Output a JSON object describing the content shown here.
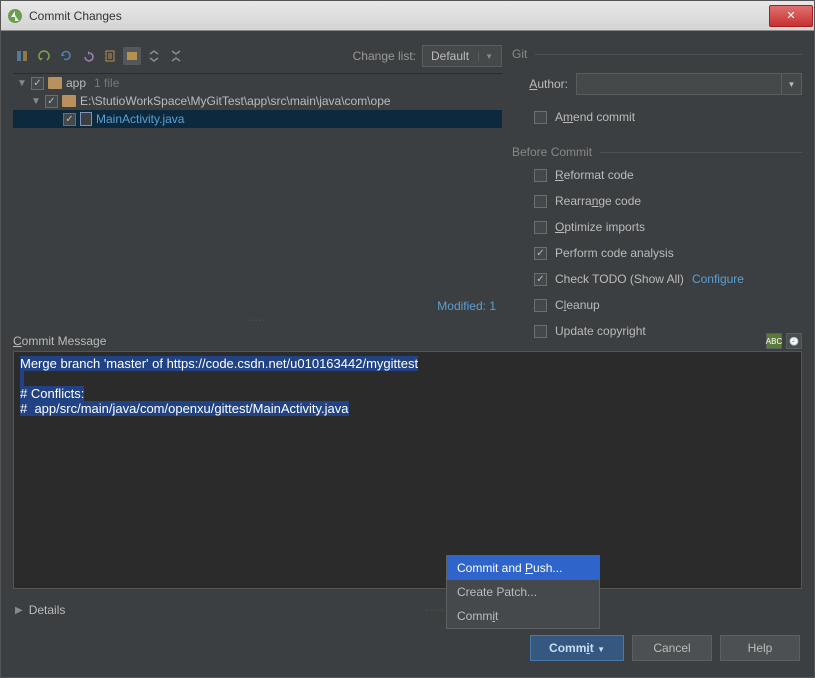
{
  "titlebar": {
    "title": "Commit Changes"
  },
  "changelist": {
    "label": "Change list:",
    "value": "Default"
  },
  "tree": {
    "root": {
      "label": "app",
      "count": "1 file"
    },
    "path": {
      "label": "E:\\StutioWorkSpace\\MyGitTest\\app\\src\\main\\java\\com\\ope"
    },
    "file": {
      "label": "MainActivity.java"
    }
  },
  "modified": "Modified: 1",
  "git": {
    "section": "Git",
    "author_label": "Author:",
    "amend_label": "Amend commit"
  },
  "before": {
    "section": "Before Commit",
    "reformat": "Reformat code",
    "rearrange": "Rearrange code",
    "optimize": "Optimize imports",
    "analysis": "Perform code analysis",
    "todo": "Check TODO (Show All)",
    "configure": "Configure",
    "cleanup": "Cleanup",
    "copyright": "Update copyright"
  },
  "commit_msg": {
    "label": "Commit Message",
    "line1": "Merge branch 'master' of https://code.csdn.net/u010163442/mygittest",
    "line2": "",
    "line3": "# Conflicts:",
    "line4": "#  app/src/main/java/com/openxu/gittest/MainActivity.java"
  },
  "details": "Details",
  "popup": {
    "commit_push": "Commit and Push...",
    "create_patch": "Create Patch...",
    "commit": "Commit"
  },
  "buttons": {
    "commit": "Commit",
    "cancel": "Cancel",
    "help": "Help"
  }
}
